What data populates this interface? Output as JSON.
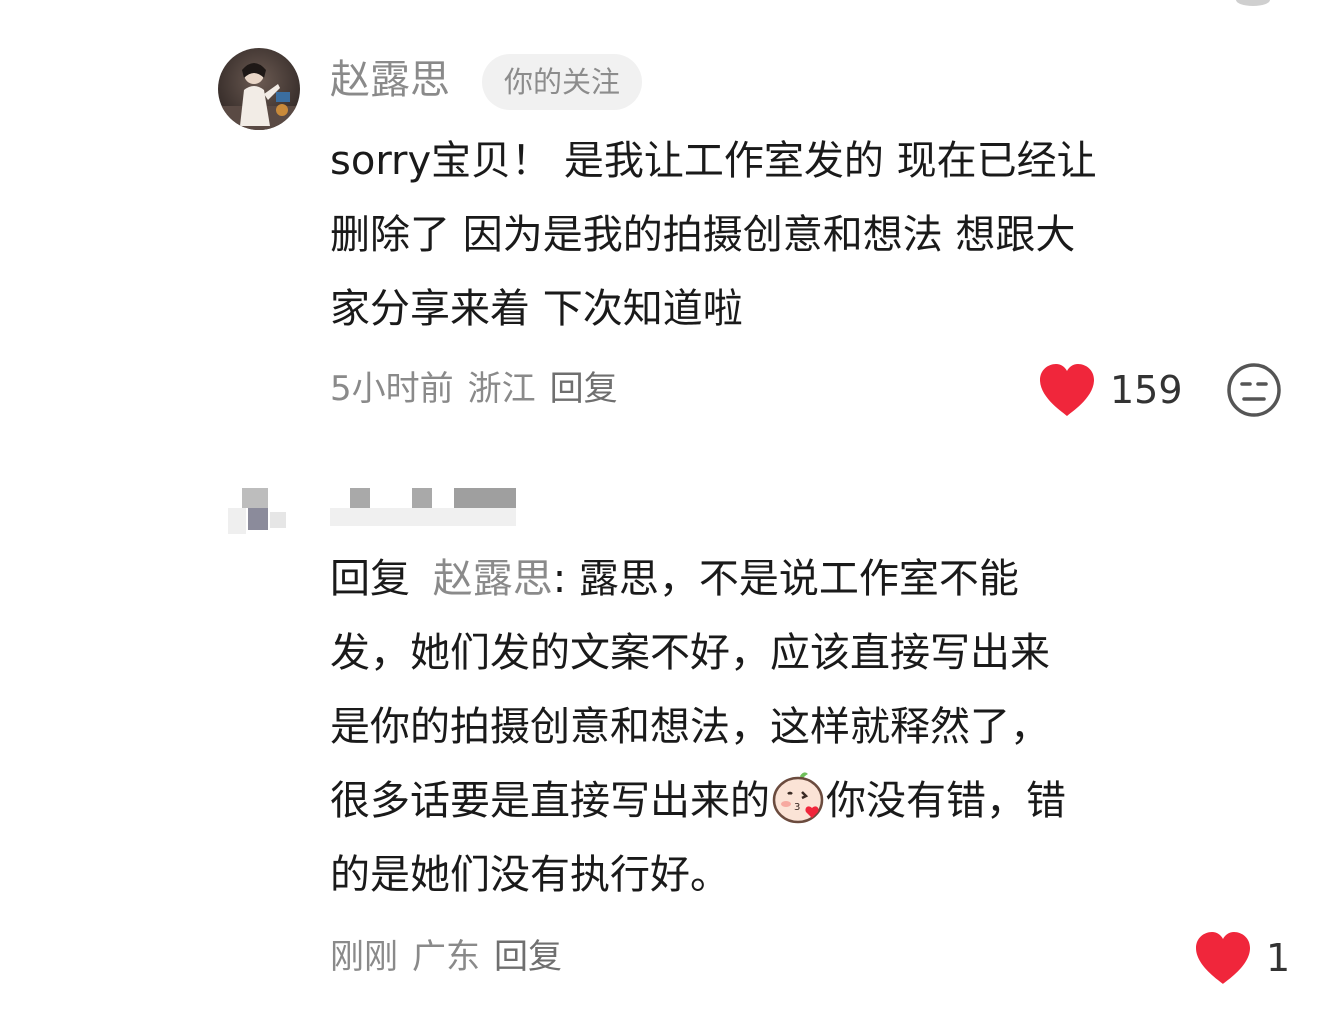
{
  "comments": [
    {
      "author": "赵露思",
      "badge": "你的关注",
      "text": "sorry宝贝！ 是我让工作室发的 现在已经让删除了 因为是我的拍摄创意和想法 想跟大家分享来着 下次知道啦",
      "lines": [
        "sorry宝贝！ 是我让工作室发的 现在已经让",
        "删除了 因为是我的拍摄创意和想法 想跟大",
        "家分享来着 下次知道啦"
      ],
      "time": "5小时前",
      "location": "浙江",
      "reply_label": "回复",
      "likes": "159"
    },
    {
      "author": "",
      "reply_prefix": "回复",
      "reply_to": "赵露思",
      "line1_rest": ": 露思，不是说工作室不能",
      "lines": [
        "发，她们发的文案不好，应该直接写出来",
        "是你的拍摄创意和想法，这样就释然了，"
      ],
      "line4_before_emoji": "很多话要是直接写出来的",
      "line4_after_emoji": "你没有错，错",
      "line5": "的是她们没有执行好。",
      "time": "刚刚",
      "location": "广东",
      "reply_label": "回复",
      "likes": "1"
    }
  ],
  "colors": {
    "like_red": "#f0263b",
    "muted_text": "#8a8a8a",
    "badge_bg": "#f1f1f1"
  },
  "icons": {
    "like": "heart-icon",
    "dislike": "neutral-face-icon",
    "emoji": "kiss-face-emoji"
  }
}
